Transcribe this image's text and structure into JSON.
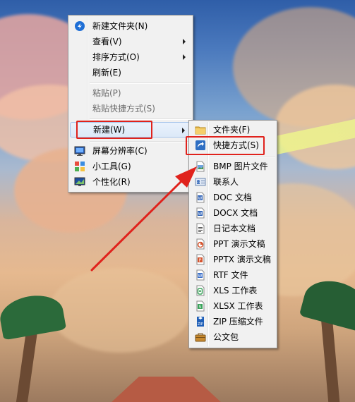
{
  "context_menu": {
    "items": [
      {
        "label": "新建文件夹(N)",
        "icon": "new-folder-icon"
      },
      {
        "label": "查看(V)"
      },
      {
        "label": "排序方式(O)"
      },
      {
        "label": "刷新(E)"
      },
      {
        "label": "粘贴(P)",
        "disabled": true
      },
      {
        "label": "粘贴快捷方式(S)",
        "disabled": true
      },
      {
        "label": "新建(W)"
      },
      {
        "label": "屏幕分辨率(C)",
        "icon": "screen-resolution-icon"
      },
      {
        "label": "小工具(G)",
        "icon": "gadgets-icon"
      },
      {
        "label": "个性化(R)",
        "icon": "personalize-icon"
      }
    ]
  },
  "new_submenu": {
    "items": [
      {
        "label": "文件夹(F)",
        "icon": "folder-icon"
      },
      {
        "label": "快捷方式(S)",
        "icon": "shortcut-icon"
      },
      {
        "label": "BMP 图片文件",
        "icon": "bmp-file-icon"
      },
      {
        "label": "联系人",
        "icon": "contact-icon"
      },
      {
        "label": "DOC 文档",
        "icon": "doc-file-icon"
      },
      {
        "label": "DOCX 文档",
        "icon": "docx-file-icon"
      },
      {
        "label": "日记本文档",
        "icon": "journal-file-icon"
      },
      {
        "label": "PPT 演示文稿",
        "icon": "ppt-file-icon"
      },
      {
        "label": "PPTX 演示文稿",
        "icon": "pptx-file-icon"
      },
      {
        "label": "RTF 文件",
        "icon": "rtf-file-icon"
      },
      {
        "label": "XLS 工作表",
        "icon": "xls-file-icon"
      },
      {
        "label": "XLSX 工作表",
        "icon": "xlsx-file-icon"
      },
      {
        "label": "ZIP 压缩文件",
        "icon": "zip-file-icon"
      },
      {
        "label": "公文包",
        "icon": "briefcase-icon"
      }
    ]
  },
  "annotations": {
    "highlight_color": "#e0221c",
    "zip_badge": "ZIP"
  }
}
